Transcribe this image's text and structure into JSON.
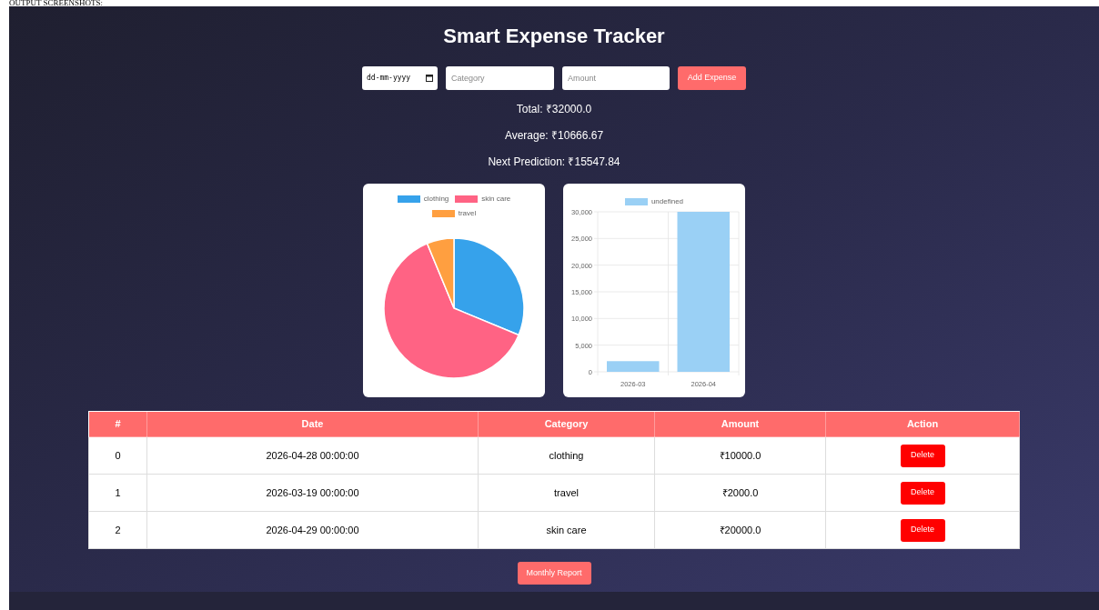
{
  "doc_heading": "OUTPUT SCREENSHOTS:",
  "app": {
    "title": "Smart Expense Tracker",
    "form": {
      "date_placeholder": "dd-mm-yyyy",
      "category_placeholder": "Category",
      "amount_placeholder": "Amount",
      "submit": "Add Expense"
    },
    "stats": [
      "Total: ₹32000.0",
      "Average: ₹10666.67",
      "Next Prediction: ₹15547.84"
    ],
    "charts": [
      {
        "chart_data": {
          "type": "pie",
          "categories": [
            "clothing",
            "skin care",
            "travel"
          ],
          "values": [
            31.25,
            62.5,
            6.25
          ],
          "legend": "top",
          "colors": [
            "#36a2eb",
            "#ff6384",
            "#ff9f40"
          ]
        }
      },
      {
        "chart_data": {
          "type": "bar",
          "categories": [
            "2026-03",
            "2026-04"
          ],
          "legend": "top",
          "grid": true,
          "series": [
            {
              "name": "undefined",
              "color": "#9ad0f5",
              "values": [
                2000,
                30000
              ]
            }
          ],
          "ylim": [
            0,
            30000
          ],
          "yticks": [
            {
              "value": 0,
              "label": "0"
            },
            {
              "value": 5000,
              "label": "5,000"
            },
            {
              "value": 10000,
              "label": "10,000"
            },
            {
              "value": 15000,
              "label": "15,000"
            },
            {
              "value": 20000,
              "label": "20,000"
            },
            {
              "value": 25000,
              "label": "25,000"
            },
            {
              "value": 30000,
              "label": "30,000"
            }
          ]
        }
      }
    ],
    "table": {
      "columns": [
        "#",
        "Date",
        "Category",
        "Amount",
        "Action"
      ],
      "rows": [
        {
          "cells": [
            "0",
            "2026-04-28 00:00:00",
            "clothing",
            "₹10000.0"
          ],
          "action": "Delete"
        },
        {
          "cells": [
            "1",
            "2026-03-19 00:00:00",
            "travel",
            "₹2000.0"
          ],
          "action": "Delete"
        },
        {
          "cells": [
            "2",
            "2026-04-29 00:00:00",
            "skin care",
            "₹20000.0"
          ],
          "action": "Delete"
        }
      ]
    },
    "report_button": "Monthly Report"
  }
}
